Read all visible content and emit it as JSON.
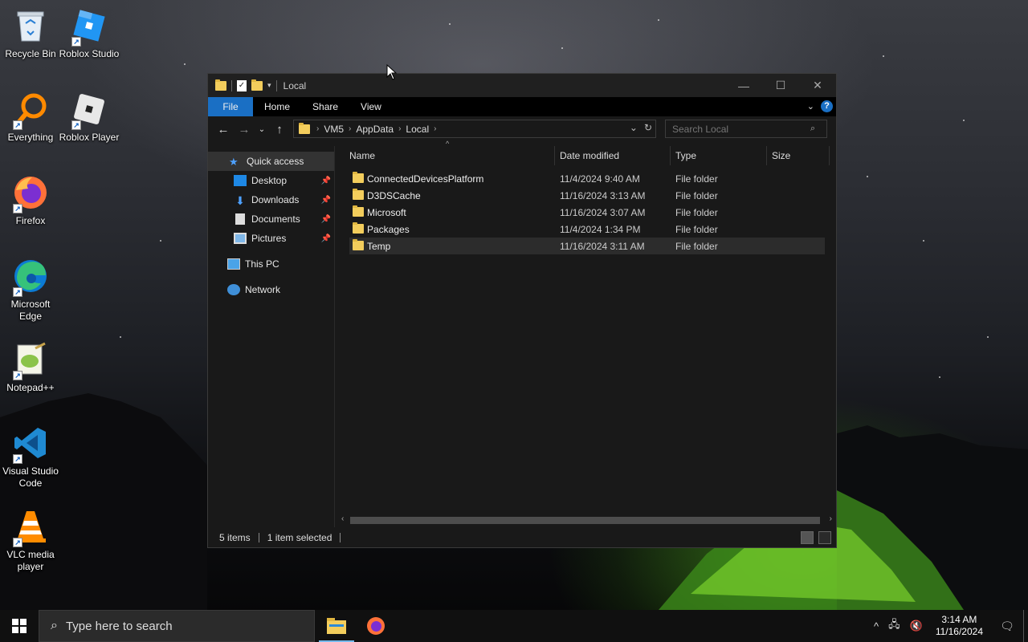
{
  "desktop": {
    "icons": [
      {
        "label": "Recycle Bin",
        "icon": "recycle-bin-icon"
      },
      {
        "label": "Roblox Studio",
        "icon": "roblox-studio-icon"
      },
      {
        "label": "Everything",
        "icon": "everything-icon"
      },
      {
        "label": "Roblox Player",
        "icon": "roblox-player-icon"
      },
      {
        "label": "Firefox",
        "icon": "firefox-icon"
      },
      {
        "label": "Microsoft Edge",
        "icon": "edge-icon"
      },
      {
        "label": "Notepad++",
        "icon": "notepadpp-icon"
      },
      {
        "label": "Visual Studio Code",
        "icon": "vscode-icon"
      },
      {
        "label": "VLC media player",
        "icon": "vlc-icon"
      }
    ]
  },
  "explorer": {
    "title": "Local",
    "ribbon_tabs": [
      "File",
      "Home",
      "Share",
      "View"
    ],
    "breadcrumb": [
      "VM5",
      "AppData",
      "Local"
    ],
    "search_placeholder": "Search Local",
    "nav": {
      "quick_access": "Quick access",
      "pinned": [
        "Desktop",
        "Downloads",
        "Documents",
        "Pictures"
      ],
      "this_pc": "This PC",
      "network": "Network"
    },
    "columns": {
      "name": "Name",
      "date": "Date modified",
      "type": "Type",
      "size": "Size"
    },
    "rows": [
      {
        "name": "ConnectedDevicesPlatform",
        "date": "11/4/2024 9:40 AM",
        "type": "File folder"
      },
      {
        "name": "D3DSCache",
        "date": "11/16/2024 3:13 AM",
        "type": "File folder"
      },
      {
        "name": "Microsoft",
        "date": "11/16/2024 3:07 AM",
        "type": "File folder"
      },
      {
        "name": "Packages",
        "date": "11/4/2024 1:34 PM",
        "type": "File folder"
      },
      {
        "name": "Temp",
        "date": "11/16/2024 3:11 AM",
        "type": "File folder"
      }
    ],
    "selected_row": "Temp",
    "status": {
      "items": "5 items",
      "selected": "1 item selected"
    }
  },
  "taskbar": {
    "search_placeholder": "Type here to search",
    "time": "3:14 AM",
    "date": "11/16/2024"
  },
  "colors": {
    "accent": "#1a6fc4",
    "folder": "#f3cd5c"
  }
}
